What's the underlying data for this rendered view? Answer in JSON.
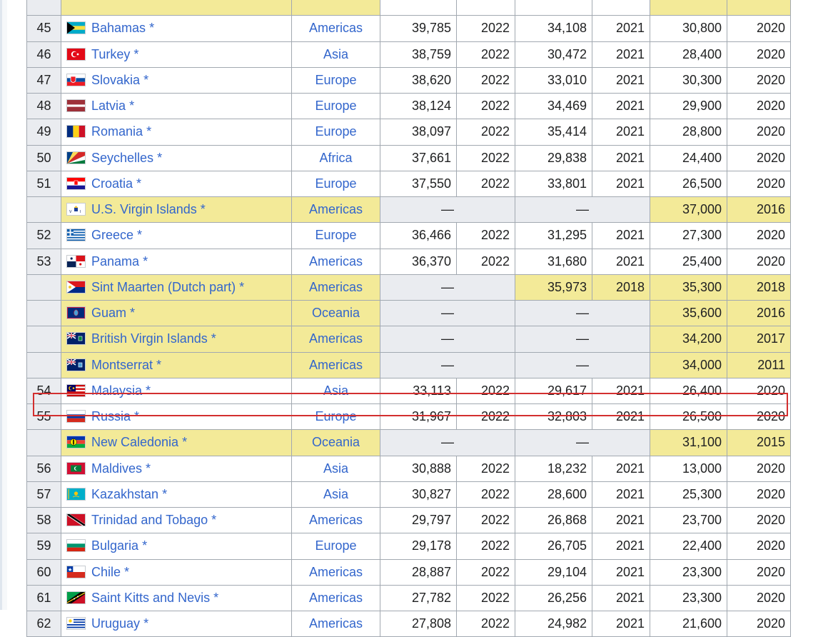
{
  "rows": [
    {
      "rank": "",
      "country": "",
      "region": "",
      "v1": "",
      "y1": "",
      "v2": "",
      "y2": "",
      "v3": "",
      "y3": "",
      "flag": "flag-partial-icon",
      "type": "partial"
    },
    {
      "rank": "45",
      "country": "Bahamas",
      "region": "Americas",
      "v1": "39,785",
      "y1": "2022",
      "v2": "34,108",
      "y2": "2021",
      "v3": "30,800",
      "y3": "2020",
      "flag": "bahamas-flag-icon"
    },
    {
      "rank": "46",
      "country": "Turkey",
      "region": "Asia",
      "v1": "38,759",
      "y1": "2022",
      "v2": "30,472",
      "y2": "2021",
      "v3": "28,400",
      "y3": "2020",
      "flag": "turkey-flag-icon"
    },
    {
      "rank": "47",
      "country": "Slovakia",
      "region": "Europe",
      "v1": "38,620",
      "y1": "2022",
      "v2": "33,010",
      "y2": "2021",
      "v3": "30,300",
      "y3": "2020",
      "flag": "slovakia-flag-icon"
    },
    {
      "rank": "48",
      "country": "Latvia",
      "region": "Europe",
      "v1": "38,124",
      "y1": "2022",
      "v2": "34,469",
      "y2": "2021",
      "v3": "29,900",
      "y3": "2020",
      "flag": "latvia-flag-icon"
    },
    {
      "rank": "49",
      "country": "Romania",
      "region": "Europe",
      "v1": "38,097",
      "y1": "2022",
      "v2": "35,414",
      "y2": "2021",
      "v3": "28,800",
      "y3": "2020",
      "flag": "romania-flag-icon"
    },
    {
      "rank": "50",
      "country": "Seychelles",
      "region": "Africa",
      "v1": "37,661",
      "y1": "2022",
      "v2": "29,838",
      "y2": "2021",
      "v3": "24,400",
      "y3": "2020",
      "flag": "seychelles-flag-icon"
    },
    {
      "rank": "51",
      "country": "Croatia",
      "region": "Europe",
      "v1": "37,550",
      "y1": "2022",
      "v2": "33,801",
      "y2": "2021",
      "v3": "26,500",
      "y3": "2020",
      "flag": "croatia-flag-icon"
    },
    {
      "rank": "",
      "country": "U.S. Virgin Islands",
      "region": "Americas",
      "v1": "—",
      "y1": "",
      "v2": "—",
      "y2": "",
      "v3": "37,000",
      "y3": "2016",
      "flag": "us-virgin-islands-flag-icon",
      "type": "terr"
    },
    {
      "rank": "52",
      "country": "Greece",
      "region": "Europe",
      "v1": "36,466",
      "y1": "2022",
      "v2": "31,295",
      "y2": "2021",
      "v3": "27,300",
      "y3": "2020",
      "flag": "greece-flag-icon"
    },
    {
      "rank": "53",
      "country": "Panama",
      "region": "Americas",
      "v1": "36,370",
      "y1": "2022",
      "v2": "31,680",
      "y2": "2021",
      "v3": "25,400",
      "y3": "2020",
      "flag": "panama-flag-icon"
    },
    {
      "rank": "",
      "country": "Sint Maarten (Dutch part)",
      "region": "Americas",
      "v1": "—",
      "y1": "",
      "v2": "35,973",
      "y2": "2018",
      "v3": "35,300",
      "y3": "2018",
      "flag": "sint-maarten-flag-icon",
      "type": "terr2"
    },
    {
      "rank": "",
      "country": "Guam",
      "region": "Oceania",
      "v1": "—",
      "y1": "",
      "v2": "—",
      "y2": "",
      "v3": "35,600",
      "y3": "2016",
      "flag": "guam-flag-icon",
      "type": "terr"
    },
    {
      "rank": "",
      "country": "British Virgin Islands",
      "region": "Americas",
      "v1": "—",
      "y1": "",
      "v2": "—",
      "y2": "",
      "v3": "34,200",
      "y3": "2017",
      "flag": "british-virgin-islands-flag-icon",
      "type": "terr"
    },
    {
      "rank": "",
      "country": "Montserrat",
      "region": "Americas",
      "v1": "—",
      "y1": "",
      "v2": "—",
      "y2": "",
      "v3": "34,000",
      "y3": "2011",
      "flag": "montserrat-flag-icon",
      "type": "terr"
    },
    {
      "rank": "54",
      "country": "Malaysia",
      "region": "Asia",
      "v1": "33,113",
      "y1": "2022",
      "v2": "29,617",
      "y2": "2021",
      "v3": "26,400",
      "y3": "2020",
      "flag": "malaysia-flag-icon"
    },
    {
      "rank": "55",
      "country": "Russia",
      "region": "Europe",
      "v1": "31,967",
      "y1": "2022",
      "v2": "32,803",
      "y2": "2021",
      "v3": "26,500",
      "y3": "2020",
      "flag": "russia-flag-icon"
    },
    {
      "rank": "",
      "country": "New Caledonia",
      "region": "Oceania",
      "v1": "—",
      "y1": "",
      "v2": "—",
      "y2": "",
      "v3": "31,100",
      "y3": "2015",
      "flag": "new-caledonia-flag-icon",
      "type": "terr"
    },
    {
      "rank": "56",
      "country": "Maldives",
      "region": "Asia",
      "v1": "30,888",
      "y1": "2022",
      "v2": "18,232",
      "y2": "2021",
      "v3": "13,000",
      "y3": "2020",
      "flag": "maldives-flag-icon"
    },
    {
      "rank": "57",
      "country": "Kazakhstan",
      "region": "Asia",
      "v1": "30,827",
      "y1": "2022",
      "v2": "28,600",
      "y2": "2021",
      "v3": "25,300",
      "y3": "2020",
      "flag": "kazakhstan-flag-icon"
    },
    {
      "rank": "58",
      "country": "Trinidad and Tobago",
      "region": "Americas",
      "v1": "29,797",
      "y1": "2022",
      "v2": "26,868",
      "y2": "2021",
      "v3": "23,700",
      "y3": "2020",
      "flag": "trinidad-flag-icon"
    },
    {
      "rank": "59",
      "country": "Bulgaria",
      "region": "Europe",
      "v1": "29,178",
      "y1": "2022",
      "v2": "26,705",
      "y2": "2021",
      "v3": "22,400",
      "y3": "2020",
      "flag": "bulgaria-flag-icon"
    },
    {
      "rank": "60",
      "country": "Chile",
      "region": "Americas",
      "v1": "28,887",
      "y1": "2022",
      "v2": "29,104",
      "y2": "2021",
      "v3": "23,300",
      "y3": "2020",
      "flag": "chile-flag-icon"
    },
    {
      "rank": "61",
      "country": "Saint Kitts and Nevis",
      "region": "Americas",
      "v1": "27,782",
      "y1": "2022",
      "v2": "26,256",
      "y2": "2021",
      "v3": "23,300",
      "y3": "2020",
      "flag": "saint-kitts-flag-icon"
    },
    {
      "rank": "62",
      "country": "Uruguay",
      "region": "Americas",
      "v1": "27,808",
      "y1": "2022",
      "v2": "24,982",
      "y2": "2021",
      "v3": "21,600",
      "y3": "2020",
      "flag": "uruguay-flag-icon",
      "type": "cut"
    }
  ],
  "star": "*",
  "highlight_color": "#d32f2f",
  "territory_color": "#f3ea98",
  "link_color": "#3366cc"
}
